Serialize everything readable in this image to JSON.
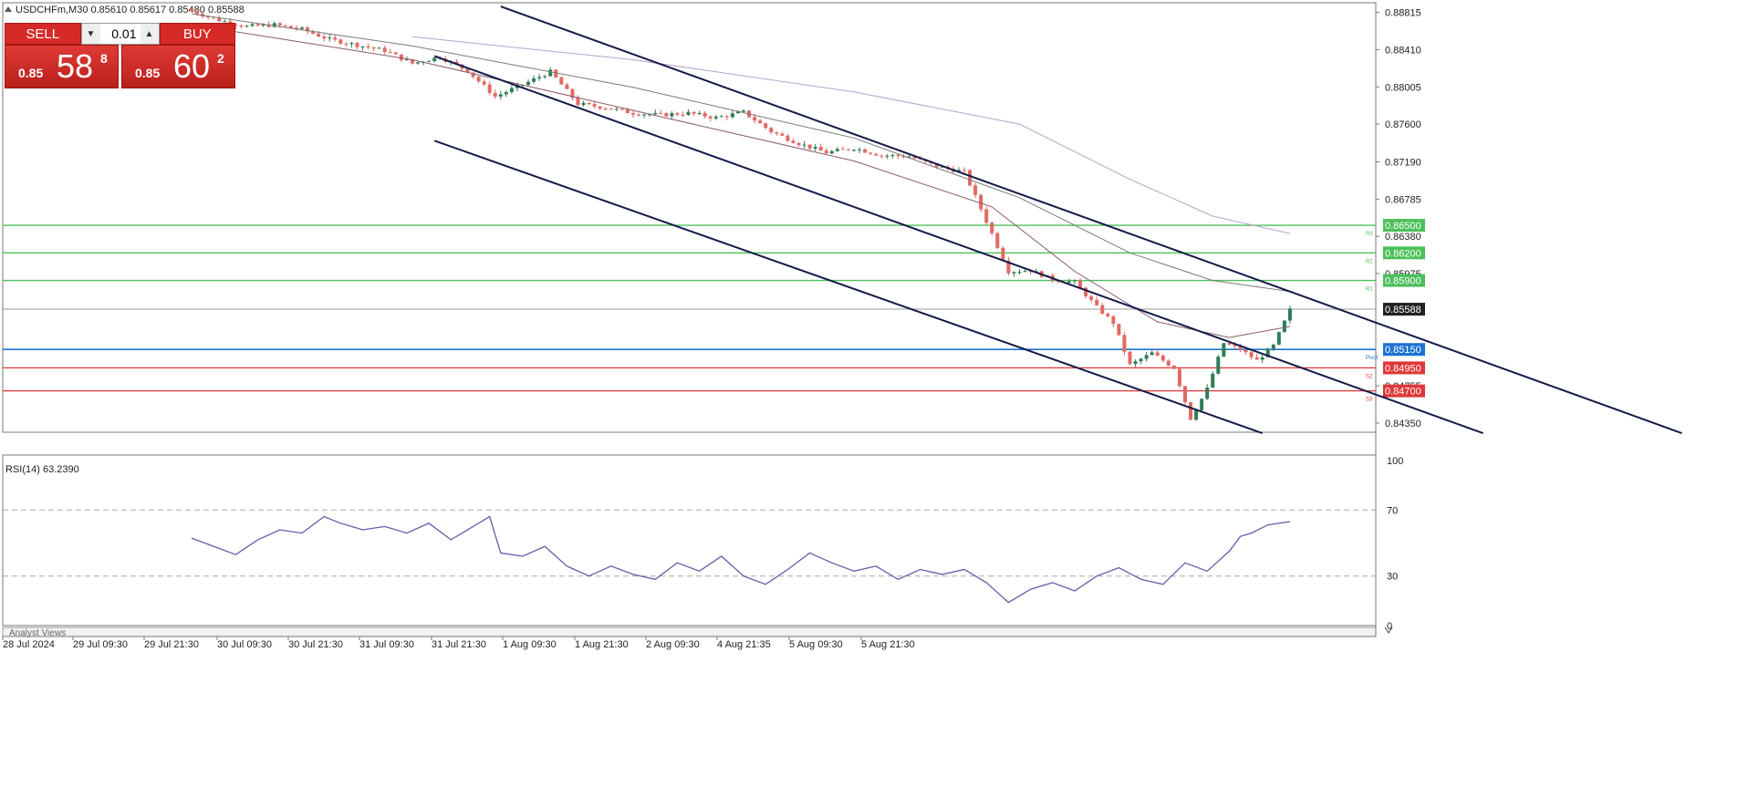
{
  "symbol_header": "USDCHFm,M30  0.85610 0.85617 0.85480 0.85588",
  "rsi_header": "RSI(14) 63.2390",
  "bottom_label": "Analyst Views",
  "trade_panel": {
    "sell_label": "SELL",
    "buy_label": "BUY",
    "lot": "0.01",
    "sell_small": "0.85",
    "sell_big": "58",
    "sell_sup": "8",
    "buy_small": "0.85",
    "buy_big": "60",
    "buy_sup": "2"
  },
  "colors": {
    "bull": "#2f7d57",
    "bear": "#e06a63",
    "channel": "#141a4a",
    "resistance": "#4cc05a",
    "pivot": "#1e73d2",
    "support": "#de3838",
    "rsi_line": "#6a5aa8"
  },
  "chart_data": [
    {
      "type": "candlestick",
      "title": "USDCHFm,M30",
      "ohlc_last": {
        "open": 0.8561,
        "high": 0.85617,
        "low": 0.8548,
        "close": 0.85588
      },
      "x_ticks": [
        "28 Jul 2024",
        "29 Jul 09:30",
        "29 Jul 21:30",
        "30 Jul 09:30",
        "30 Jul 21:30",
        "31 Jul 09:30",
        "31 Jul 21:30",
        "1 Aug 09:30",
        "1 Aug 21:30",
        "2 Aug 09:30",
        "4 Aug 21:35",
        "5 Aug 09:30",
        "5 Aug 21:30"
      ],
      "y_ticks": [
        0.88815,
        0.8841,
        0.88005,
        0.876,
        0.8719,
        0.86785,
        0.8638,
        0.85975,
        0.84755,
        0.8435
      ],
      "ylim": [
        0.8425,
        0.8892
      ],
      "current_price": 0.85588,
      "bars_shown": 200,
      "close_path": [
        {
          "bar": 0,
          "close": 0.8883
        },
        {
          "bar": 5,
          "close": 0.8873
        },
        {
          "bar": 10,
          "close": 0.8866
        },
        {
          "bar": 15,
          "close": 0.8868
        },
        {
          "bar": 20,
          "close": 0.8863
        },
        {
          "bar": 25,
          "close": 0.8852
        },
        {
          "bar": 30,
          "close": 0.8846
        },
        {
          "bar": 35,
          "close": 0.884
        },
        {
          "bar": 40,
          "close": 0.8826
        },
        {
          "bar": 45,
          "close": 0.8833
        },
        {
          "bar": 50,
          "close": 0.8818
        },
        {
          "bar": 55,
          "close": 0.879
        },
        {
          "bar": 60,
          "close": 0.8803
        },
        {
          "bar": 65,
          "close": 0.8817
        },
        {
          "bar": 70,
          "close": 0.8782
        },
        {
          "bar": 75,
          "close": 0.8778
        },
        {
          "bar": 80,
          "close": 0.8772
        },
        {
          "bar": 85,
          "close": 0.877
        },
        {
          "bar": 90,
          "close": 0.8772
        },
        {
          "bar": 95,
          "close": 0.8767
        },
        {
          "bar": 100,
          "close": 0.8773
        },
        {
          "bar": 105,
          "close": 0.8752
        },
        {
          "bar": 110,
          "close": 0.8739
        },
        {
          "bar": 115,
          "close": 0.8729
        },
        {
          "bar": 120,
          "close": 0.8734
        },
        {
          "bar": 125,
          "close": 0.8726
        },
        {
          "bar": 130,
          "close": 0.8725
        },
        {
          "bar": 135,
          "close": 0.8714
        },
        {
          "bar": 140,
          "close": 0.8708
        },
        {
          "bar": 145,
          "close": 0.8641
        },
        {
          "bar": 148,
          "close": 0.86
        },
        {
          "bar": 152,
          "close": 0.8601
        },
        {
          "bar": 156,
          "close": 0.8591
        },
        {
          "bar": 160,
          "close": 0.8588
        },
        {
          "bar": 164,
          "close": 0.8561
        },
        {
          "bar": 167,
          "close": 0.8544
        },
        {
          "bar": 170,
          "close": 0.8498
        },
        {
          "bar": 174,
          "close": 0.8511
        },
        {
          "bar": 178,
          "close": 0.8495
        },
        {
          "bar": 181,
          "close": 0.844
        },
        {
          "bar": 184,
          "close": 0.8472
        },
        {
          "bar": 187,
          "close": 0.8522
        },
        {
          "bar": 190,
          "close": 0.8515
        },
        {
          "bar": 193,
          "close": 0.8503
        },
        {
          "bar": 196,
          "close": 0.8519
        },
        {
          "bar": 199,
          "close": 0.8558
        }
      ],
      "moving_averages": [
        {
          "color": "#7a7a7a",
          "points": [
            {
              "bar": 0,
              "value": 0.888
            },
            {
              "bar": 40,
              "value": 0.8845
            },
            {
              "bar": 80,
              "value": 0.88
            },
            {
              "bar": 120,
              "value": 0.8745
            },
            {
              "bar": 150,
              "value": 0.868
            },
            {
              "bar": 170,
              "value": 0.862
            },
            {
              "bar": 185,
              "value": 0.859
            },
            {
              "bar": 199,
              "value": 0.8578
            }
          ]
        },
        {
          "color": "#8a5a6a",
          "points": [
            {
              "bar": 0,
              "value": 0.8868
            },
            {
              "bar": 40,
              "value": 0.883
            },
            {
              "bar": 80,
              "value": 0.8775
            },
            {
              "bar": 120,
              "value": 0.872
            },
            {
              "bar": 145,
              "value": 0.867
            },
            {
              "bar": 160,
              "value": 0.86
            },
            {
              "bar": 175,
              "value": 0.8545
            },
            {
              "bar": 188,
              "value": 0.8528
            },
            {
              "bar": 199,
              "value": 0.854
            }
          ]
        },
        {
          "color": "#b8a0c8",
          "points": [
            {
              "bar": 40,
              "value": 0.8855
            },
            {
              "bar": 80,
              "value": 0.883
            },
            {
              "bar": 120,
              "value": 0.8795
            },
            {
              "bar": 150,
              "value": 0.876
            },
            {
              "bar": 170,
              "value": 0.87
            },
            {
              "bar": 185,
              "value": 0.866
            },
            {
              "bar": 199,
              "value": 0.8641
            }
          ]
        }
      ],
      "channel_lines": [
        {
          "from": {
            "bar": 56,
            "price": 0.8888
          },
          "to": {
            "bar": 270,
            "price": 0.8424
          }
        },
        {
          "from": {
            "bar": 44,
            "price": 0.8834
          },
          "to": {
            "bar": 234,
            "price": 0.8424
          }
        },
        {
          "from": {
            "bar": 44,
            "price": 0.8742
          },
          "to": {
            "bar": 194,
            "price": 0.8424
          }
        }
      ],
      "horizontal_levels": [
        {
          "price": 0.865,
          "label": "0.86500",
          "name": "R3",
          "color": "#4cc05a"
        },
        {
          "price": 0.862,
          "label": "0.86200",
          "name": "R2",
          "color": "#4cc05a"
        },
        {
          "price": 0.859,
          "label": "0.85900",
          "name": "R1",
          "color": "#4cc05a"
        },
        {
          "price": 0.8515,
          "label": "0.85150",
          "name": "Pivot",
          "color": "#1e73d2"
        },
        {
          "price": 0.8495,
          "label": "0.84950",
          "name": "S2",
          "color": "#de3838"
        },
        {
          "price": 0.847,
          "label": "0.84700",
          "name": "S3",
          "color": "#de3838"
        }
      ]
    },
    {
      "type": "line",
      "title": "RSI(14) 63.2390",
      "ylim": [
        0,
        100
      ],
      "y_ticks": [
        100,
        70,
        30,
        0
      ],
      "levels": [
        70,
        30
      ],
      "current": 63.239,
      "points": [
        {
          "bar": 0,
          "value": 53
        },
        {
          "bar": 4,
          "value": 48
        },
        {
          "bar": 8,
          "value": 43
        },
        {
          "bar": 12,
          "value": 52
        },
        {
          "bar": 16,
          "value": 58
        },
        {
          "bar": 20,
          "value": 56
        },
        {
          "bar": 24,
          "value": 66
        },
        {
          "bar": 27,
          "value": 62
        },
        {
          "bar": 31,
          "value": 58
        },
        {
          "bar": 35,
          "value": 60
        },
        {
          "bar": 39,
          "value": 56
        },
        {
          "bar": 43,
          "value": 62
        },
        {
          "bar": 47,
          "value": 52
        },
        {
          "bar": 51,
          "value": 60
        },
        {
          "bar": 54,
          "value": 66
        },
        {
          "bar": 56,
          "value": 44
        },
        {
          "bar": 60,
          "value": 42
        },
        {
          "bar": 64,
          "value": 48
        },
        {
          "bar": 68,
          "value": 36
        },
        {
          "bar": 72,
          "value": 30
        },
        {
          "bar": 76,
          "value": 36
        },
        {
          "bar": 80,
          "value": 31
        },
        {
          "bar": 84,
          "value": 28
        },
        {
          "bar": 88,
          "value": 38
        },
        {
          "bar": 92,
          "value": 33
        },
        {
          "bar": 96,
          "value": 42
        },
        {
          "bar": 100,
          "value": 30
        },
        {
          "bar": 104,
          "value": 25
        },
        {
          "bar": 108,
          "value": 34
        },
        {
          "bar": 112,
          "value": 44
        },
        {
          "bar": 116,
          "value": 38
        },
        {
          "bar": 120,
          "value": 33
        },
        {
          "bar": 124,
          "value": 36
        },
        {
          "bar": 128,
          "value": 28
        },
        {
          "bar": 132,
          "value": 34
        },
        {
          "bar": 136,
          "value": 31
        },
        {
          "bar": 140,
          "value": 34
        },
        {
          "bar": 144,
          "value": 26
        },
        {
          "bar": 148,
          "value": 14
        },
        {
          "bar": 152,
          "value": 22
        },
        {
          "bar": 156,
          "value": 26
        },
        {
          "bar": 160,
          "value": 21
        },
        {
          "bar": 164,
          "value": 30
        },
        {
          "bar": 168,
          "value": 35
        },
        {
          "bar": 172,
          "value": 28
        },
        {
          "bar": 176,
          "value": 25
        },
        {
          "bar": 180,
          "value": 38
        },
        {
          "bar": 184,
          "value": 33
        },
        {
          "bar": 188,
          "value": 45
        },
        {
          "bar": 190,
          "value": 54
        },
        {
          "bar": 192,
          "value": 56
        },
        {
          "bar": 195,
          "value": 61
        },
        {
          "bar": 199,
          "value": 63
        }
      ]
    }
  ]
}
